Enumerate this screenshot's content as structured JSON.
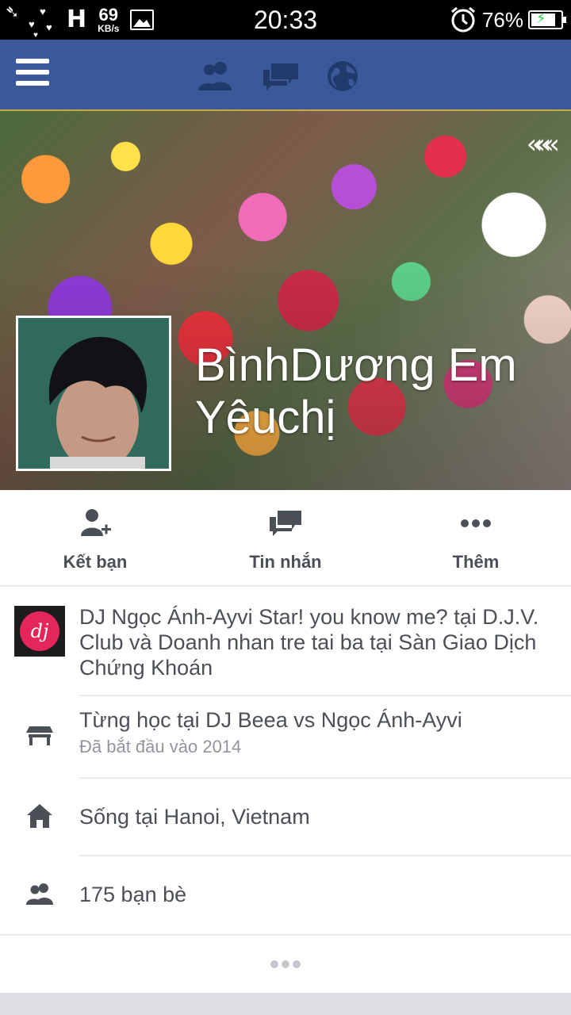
{
  "status_bar": {
    "network": "H",
    "speed_value": "69",
    "speed_unit": "KB/s",
    "time": "20:33",
    "battery_percent": "76%",
    "battery_level": 0.76
  },
  "navbar": {
    "icons": [
      "menu-icon",
      "friends-icon",
      "messages-icon",
      "globe-icon"
    ],
    "color": "#3b5998"
  },
  "profile": {
    "name": "BìnhDương Em Yêuchị"
  },
  "actions": [
    {
      "label": "Kết bạn",
      "icon": "add-friend-icon"
    },
    {
      "label": "Tin nhắn",
      "icon": "message-icon"
    },
    {
      "label": "Thêm",
      "icon": "more-icon"
    }
  ],
  "info": {
    "work": "DJ Ngọc Ánh-Ayvi Star! you know me? tại D.J.V. Club và Doanh nhan tre tai ba tại Sàn Giao Dịch Chứng Khoán",
    "education": "Từng học tại DJ Beea vs Ngọc Ánh-Ayvi",
    "education_sub": "Đã bắt đầu vào 2014",
    "lives": "Sống tại Hanoi, Vietnam",
    "friends": "175 bạn bè"
  },
  "colors": {
    "text": "#4b4f56",
    "muted": "#90949c",
    "divider": "#e9eaed"
  }
}
